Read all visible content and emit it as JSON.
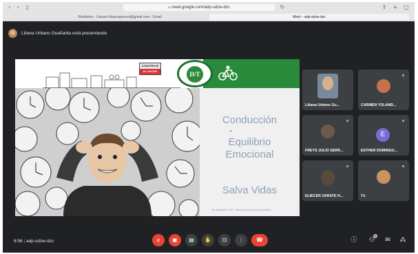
{
  "browser": {
    "url": "meet.google.com/adp-sdzw-dzc",
    "tabs": [
      {
        "label": "Recibidos - l.tarazo.hbancaprouvo@gmail.com - Gmail"
      },
      {
        "label": "Meet – adp-sdzw-dzc"
      }
    ],
    "nav_icons": [
      "back-icon",
      "forward-icon",
      "sidebar-icon"
    ],
    "right_icons": [
      "share-icon",
      "new-tab-icon",
      "tabs-icon"
    ]
  },
  "meet": {
    "presenter_text": "Liliana Urbano Guañarita está presentando",
    "slide": {
      "sign_line1": "CONSTRUYE",
      "sign_line2": "EL HACER",
      "logo_text": "D/T",
      "line_conduccion": "Conducción",
      "line_equilibrio": "Equilibrio",
      "line_emocional": "Emocional",
      "line_salva": "Salva Vidas",
      "small_print": "ML Delgadillo EXXT - Dirección de la cultura Guañarita"
    },
    "participants": [
      {
        "name": "Liliana Urbano Gu...",
        "type": "video"
      },
      {
        "name": "CARMEN YOLAND...",
        "type": "video"
      },
      {
        "name": "FREYS JULIO SERR...",
        "type": "video"
      },
      {
        "name": "ESTHER DOMINGU...",
        "type": "letter",
        "letter": "E"
      },
      {
        "name": "ELIECER ZARATE H...",
        "type": "video"
      },
      {
        "name": "Tú",
        "type": "video"
      }
    ],
    "meeting_time": "6:56",
    "meeting_code": "adp-sdzw-dzc",
    "participant_count": "6",
    "colors": {
      "accent_red": "#ea4335",
      "meet_bg": "#202124",
      "slide_green": "#2a8a3c",
      "slide_text": "#8f9fb8"
    }
  }
}
